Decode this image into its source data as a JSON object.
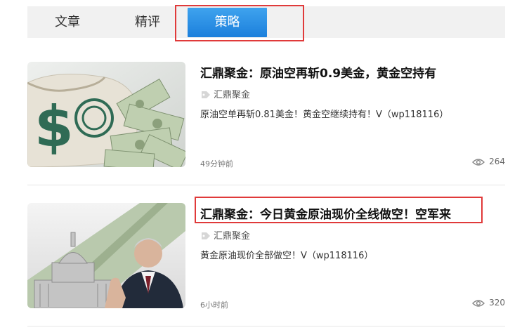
{
  "tabs": [
    {
      "label": "文章"
    },
    {
      "label": "精评"
    },
    {
      "label": "策略",
      "active": true
    }
  ],
  "articles": [
    {
      "title": "汇鼎聚金：原油空再斩0.9美金，黄金空持有",
      "source": "汇鼎聚金",
      "desc": "原油空单再斩0.81美金！黄金空继续持有！V（wp118116）",
      "time": "49分钟前",
      "views": "264",
      "thumb_icon": "money-bag-image"
    },
    {
      "title": "汇鼎聚金：今日黄金原油现价全线做空！空军来",
      "source": "汇鼎聚金",
      "desc": "黄金原油现价全部做空！V（wp118116）",
      "time": "6小时前",
      "views": "320",
      "thumb_icon": "capitol-fed-chair-image"
    }
  ],
  "colors": {
    "active_tab": "#1b7fdc",
    "highlight": "#e03a3a"
  }
}
